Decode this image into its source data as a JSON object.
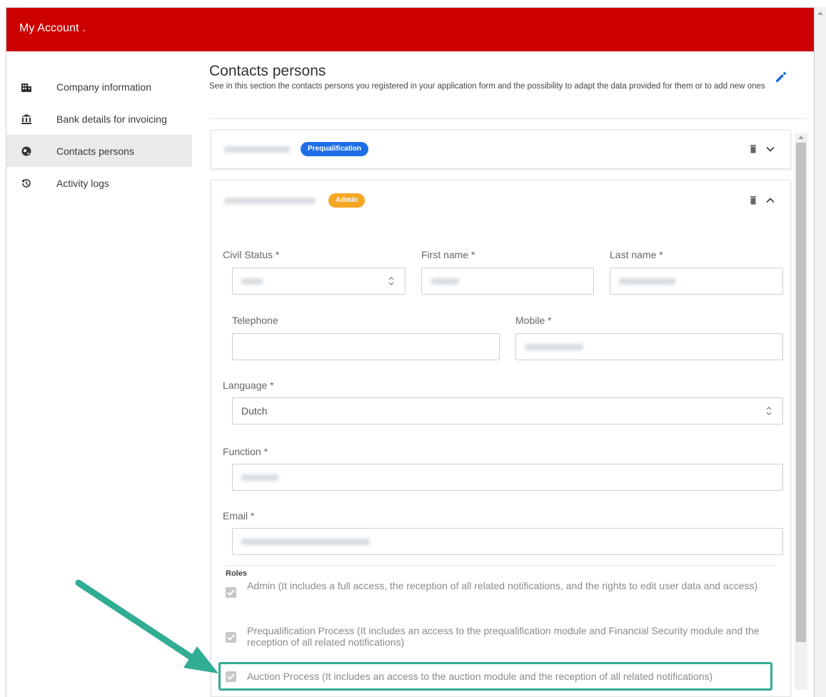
{
  "app": {
    "title": "My Account ."
  },
  "sidebar": {
    "items": [
      {
        "label": "Company information",
        "icon": "building-icon",
        "active": false
      },
      {
        "label": "Bank details for invoicing",
        "icon": "bank-icon",
        "active": false
      },
      {
        "label": "Contacts persons",
        "icon": "globe-icon",
        "active": true
      },
      {
        "label": "Activity logs",
        "icon": "history-icon",
        "active": false
      }
    ]
  },
  "main": {
    "title": "Contacts persons",
    "subtitle": "See in this section the contacts persons you registered in your application form and the possibility to adapt the data provided for them or to add new ones"
  },
  "contacts": [
    {
      "badge": "Prequalification",
      "badge_color": "#1e6fe6",
      "expanded": false
    },
    {
      "badge": "Admin",
      "badge_color": "#f5a623",
      "expanded": true
    }
  ],
  "form": {
    "civil_status_label": "Civil Status *",
    "first_name_label": "First name *",
    "last_name_label": "Last name *",
    "telephone_label": "Telephone",
    "mobile_label": "Mobile *",
    "language_label": "Language *",
    "language_value": "Dutch",
    "function_label": "Function *",
    "email_label": "Email *",
    "roles_label": "Roles",
    "roles": [
      {
        "label": "Admin (It includes a full access, the reception of all related notifications, and the rights to edit user data and access)",
        "checked": true
      },
      {
        "label": "Prequalification Process (It includes an access to the prequalification module and Financial Security module and the reception of all related notifications)",
        "checked": true
      },
      {
        "label": "Auction Process (It includes an access to the auction module and the reception of all related notifications)",
        "checked": true
      }
    ]
  },
  "colors": {
    "topbar": "#cc0000",
    "highlight": "#30ad93",
    "primary": "#1e6fe6"
  }
}
